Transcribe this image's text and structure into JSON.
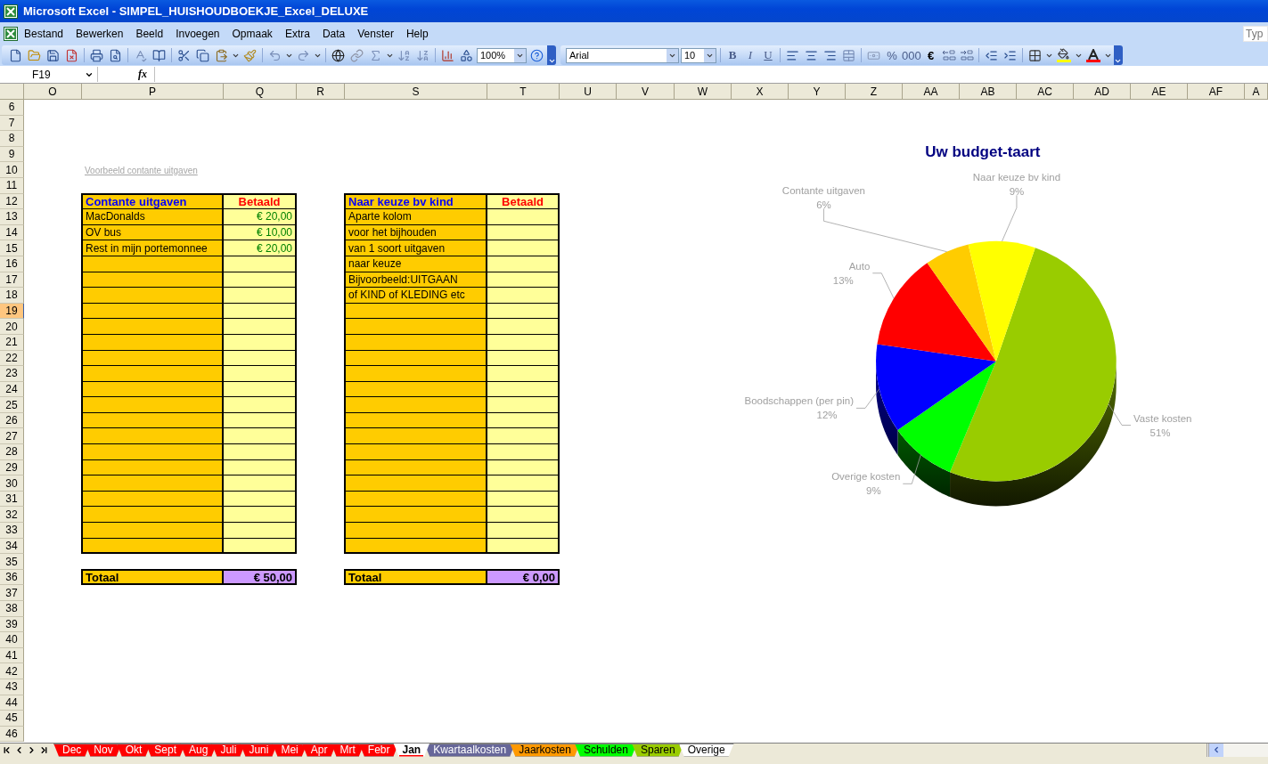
{
  "window": {
    "title": "Microsoft Excel - SIMPEL_HUISHOUDBOEKJE_Excel_DELUXE"
  },
  "menu": [
    "Bestand",
    "Bewerken",
    "Beeld",
    "Invoegen",
    "Opmaak",
    "Extra",
    "Data",
    "Venster",
    "Help"
  ],
  "help_field": {
    "placeholder": "Typ"
  },
  "toolbar": {
    "zoom": "100%",
    "font": "Arial",
    "font_size": "10",
    "bold": "B",
    "italic": "I",
    "underline": "U",
    "percent": "%",
    "thousands": "000",
    "euro": "€"
  },
  "formula_bar": {
    "name_box": "F19",
    "fx": "fx"
  },
  "columns": [
    "O",
    "P",
    "Q",
    "R",
    "S",
    "T",
    "U",
    "V",
    "W",
    "X",
    "Y",
    "Z",
    "AA",
    "AB",
    "AC",
    "AD",
    "AE",
    "AF",
    "A"
  ],
  "rows": [
    {
      "label": "6",
      "selected": false
    },
    {
      "label": "7",
      "selected": false
    },
    {
      "label": "8",
      "selected": false
    },
    {
      "label": "9",
      "selected": false
    },
    {
      "label": "10",
      "selected": false
    },
    {
      "label": "11",
      "selected": false
    },
    {
      "label": "12",
      "selected": false
    },
    {
      "label": "13",
      "selected": false
    },
    {
      "label": "14",
      "selected": false
    },
    {
      "label": "15",
      "selected": false
    },
    {
      "label": "16",
      "selected": false
    },
    {
      "label": "17",
      "selected": false
    },
    {
      "label": "18",
      "selected": false
    },
    {
      "label": "19",
      "selected": true
    },
    {
      "label": "20",
      "selected": false
    },
    {
      "label": "21",
      "selected": false
    },
    {
      "label": "22",
      "selected": false
    },
    {
      "label": "23",
      "selected": false
    },
    {
      "label": "24",
      "selected": false
    },
    {
      "label": "25",
      "selected": false
    },
    {
      "label": "26",
      "selected": false
    },
    {
      "label": "27",
      "selected": false
    },
    {
      "label": "28",
      "selected": false
    },
    {
      "label": "29",
      "selected": false
    },
    {
      "label": "30",
      "selected": false
    },
    {
      "label": "31",
      "selected": false
    },
    {
      "label": "32",
      "selected": false
    },
    {
      "label": "33",
      "selected": false
    },
    {
      "label": "34",
      "selected": false
    },
    {
      "label": "35",
      "selected": false
    },
    {
      "label": "36",
      "selected": false
    },
    {
      "label": "37",
      "selected": false
    },
    {
      "label": "38",
      "selected": false
    },
    {
      "label": "39",
      "selected": false
    },
    {
      "label": "40",
      "selected": false
    },
    {
      "label": "41",
      "selected": false
    },
    {
      "label": "42",
      "selected": false
    },
    {
      "label": "43",
      "selected": false
    },
    {
      "label": "44",
      "selected": false
    },
    {
      "label": "45",
      "selected": false
    },
    {
      "label": "46",
      "selected": false
    }
  ],
  "note_link": "Voorbeeld contante uitgaven",
  "tables": [
    {
      "header": "Contante uitgaven",
      "paid_header": "Betaald",
      "entries": [
        {
          "label": "MacDonalds",
          "amount": "€ 20,00"
        },
        {
          "label": "OV bus",
          "amount": "€ 10,00"
        },
        {
          "label": "Rest in mijn portemonnee",
          "amount": "€ 20,00"
        }
      ],
      "total_label": "Totaal",
      "total": "€ 50,00"
    },
    {
      "header": "Naar keuze bv kind",
      "paid_header": "Betaald",
      "entries": [
        {
          "label": "Aparte kolom"
        },
        {
          "label": "voor het bijhouden"
        },
        {
          "label": "van 1 soort uitgaven"
        },
        {
          "label": "naar keuze"
        },
        {
          "label": "Bijvoorbeeld:UITGAAN"
        },
        {
          "label": "of KIND of KLEDING etc"
        }
      ],
      "total_label": "Totaal",
      "total": "€ 0,00"
    }
  ],
  "chart": {
    "chart_data": {
      "type": "pie",
      "title": "Uw budget-taart",
      "categories": [
        "Vaste kosten",
        "Overige kosten",
        "Boodschappen (per pin)",
        "Auto",
        "Contante uitgaven",
        "Naar keuze bv kind"
      ],
      "values": [
        51,
        9,
        12,
        13,
        6,
        9
      ],
      "value_labels": [
        "51%",
        "9%",
        "12%",
        "13%",
        "6%",
        "9%"
      ],
      "colors": [
        "#99cc00",
        "#00ff00",
        "#0000ff",
        "#ff0000",
        "#ffcc00",
        "#ffff00"
      ]
    }
  },
  "sheet_tabs": [
    {
      "label": "Dec",
      "color": "#ff0000",
      "selected": false
    },
    {
      "label": "Nov",
      "color": "#ff0000",
      "selected": false
    },
    {
      "label": "Okt",
      "color": "#ff0000",
      "selected": false
    },
    {
      "label": "Sept",
      "color": "#ff0000",
      "selected": false
    },
    {
      "label": "Aug",
      "color": "#ff0000",
      "selected": false
    },
    {
      "label": "Juli",
      "color": "#ff0000",
      "selected": false
    },
    {
      "label": "Juni",
      "color": "#ff0000",
      "selected": false
    },
    {
      "label": "Mei",
      "color": "#ff0000",
      "selected": false
    },
    {
      "label": "Apr",
      "color": "#ff0000",
      "selected": false
    },
    {
      "label": "Mrt",
      "color": "#ff0000",
      "selected": false
    },
    {
      "label": "Febr",
      "color": "#ff0000",
      "selected": false
    },
    {
      "label": "Jan",
      "color": "#ff0000",
      "selected": true
    },
    {
      "label": "Kwartaalkosten",
      "color": "#666699",
      "selected": false
    },
    {
      "label": "Jaarkosten",
      "color": "#ff9900",
      "selected": false
    },
    {
      "label": "Schulden",
      "color": "#00ff00",
      "selected": false
    },
    {
      "label": "Sparen",
      "color": "#99cc00",
      "selected": false
    },
    {
      "label": "Overige",
      "selected": false
    }
  ]
}
